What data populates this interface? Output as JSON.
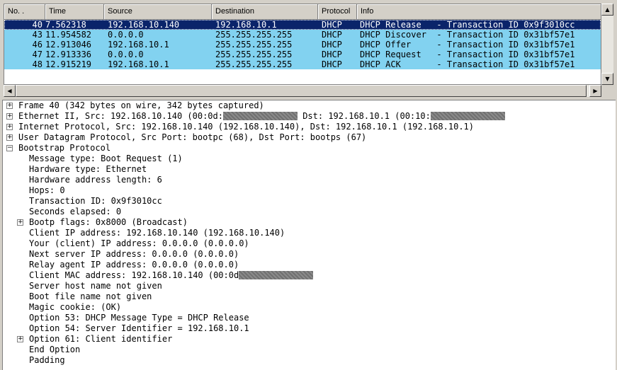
{
  "packet_list": {
    "columns": [
      "No. .",
      "Time",
      "Source",
      "Destination",
      "Protocol",
      "Info"
    ],
    "rows": [
      {
        "no": "40",
        "time": "7.562318",
        "source": "192.168.10.140",
        "destination": "192.168.10.1",
        "protocol": "DHCP",
        "info": "DHCP Release   - Transaction ID 0x9f3010cc",
        "selected": true
      },
      {
        "no": "43",
        "time": "11.954582",
        "source": "0.0.0.0",
        "destination": "255.255.255.255",
        "protocol": "DHCP",
        "info": "DHCP Discover  - Transaction ID 0x31bf57e1"
      },
      {
        "no": "46",
        "time": "12.913046",
        "source": "192.168.10.1",
        "destination": "255.255.255.255",
        "protocol": "DHCP",
        "info": "DHCP Offer     - Transaction ID 0x31bf57e1"
      },
      {
        "no": "47",
        "time": "12.913336",
        "source": "0.0.0.0",
        "destination": "255.255.255.255",
        "protocol": "DHCP",
        "info": "DHCP Request   - Transaction ID 0x31bf57e1"
      },
      {
        "no": "48",
        "time": "12.915219",
        "source": "192.168.10.1",
        "destination": "255.255.255.255",
        "protocol": "DHCP",
        "info": "DHCP ACK       - Transaction ID 0x31bf57e1"
      }
    ]
  },
  "details": {
    "frame": "Frame 40 (342 bytes on wire, 342 bytes captured)",
    "ethernet_a": "Ethernet II, Src: 192.168.10.140 (00:0d:",
    "ethernet_b": " Dst: 192.168.10.1 (00:10:",
    "ip": "Internet Protocol, Src: 192.168.10.140 (192.168.10.140), Dst: 192.168.10.1 (192.168.10.1)",
    "udp": "User Datagram Protocol, Src Port: bootpc (68), Dst Port: bootps (67)",
    "bootp": "Bootstrap Protocol",
    "fields": [
      "Message type: Boot Request (1)",
      "Hardware type: Ethernet",
      "Hardware address length: 6",
      "Hops: 0",
      "Transaction ID: 0x9f3010cc",
      "Seconds elapsed: 0"
    ],
    "bootp_flags": "Bootp flags: 0x8000 (Broadcast)",
    "fields2": [
      "Client IP address: 192.168.10.140 (192.168.10.140)",
      "Your (client) IP address: 0.0.0.0 (0.0.0.0)",
      "Next server IP address: 0.0.0.0 (0.0.0.0)",
      "Relay agent IP address: 0.0.0.0 (0.0.0.0)"
    ],
    "client_mac": "Client MAC address: 192.168.10.140 (00:0d",
    "fields3": [
      "Server host name not given",
      "Boot file name not given",
      "Magic cookie: (OK)",
      "Option 53: DHCP Message Type = DHCP Release",
      "Option 54: Server Identifier = 192.168.10.1"
    ],
    "option61": "Option 61: Client identifier",
    "fields4": [
      "End Option",
      "Padding"
    ]
  },
  "icons": {
    "expand": "+",
    "collapse": "−",
    "scroll_up": "▲",
    "scroll_down": "▼",
    "scroll_left": "◀",
    "scroll_right": "▶"
  },
  "colors": {
    "row_bg": "#82d2f0",
    "selected_bg": "#0a246a"
  }
}
